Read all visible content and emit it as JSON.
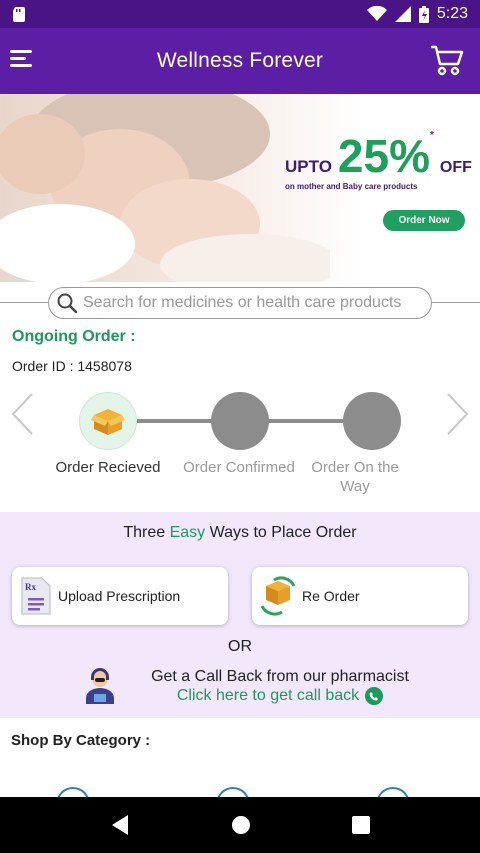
{
  "status_bar": {
    "time": "5:23"
  },
  "app_bar": {
    "title": "Wellness Forever"
  },
  "banner": {
    "upto": "UPTO",
    "percent": "25%",
    "asterisk": "*",
    "off": "OFF",
    "subtitle": "on mother and Baby care products",
    "cta": "Order Now"
  },
  "search": {
    "placeholder": "Search for medicines or health care products"
  },
  "order": {
    "heading": "Ongoing Order :",
    "id_label": "Order ID :",
    "id_value": "1458078",
    "steps": [
      {
        "label": "Order Recieved"
      },
      {
        "label": "Order Confirmed"
      },
      {
        "label": "Order On the Way"
      }
    ]
  },
  "ways": {
    "title_before": "Three",
    "title_highlight": "Easy",
    "title_after": "Ways to Place Order",
    "upload_label": "Upload Prescription",
    "reorder_label": "Re Order",
    "or_text": "OR",
    "callback_title": "Get a Call Back from our pharmacist",
    "callback_link": "Click here to get call back"
  },
  "shop": {
    "title": "Shop By Category :"
  },
  "colors": {
    "primary": "#5c1ea4",
    "status": "#4a1487",
    "accent_green": "#1a9c5b",
    "ways_bg": "#f2e7fb"
  }
}
